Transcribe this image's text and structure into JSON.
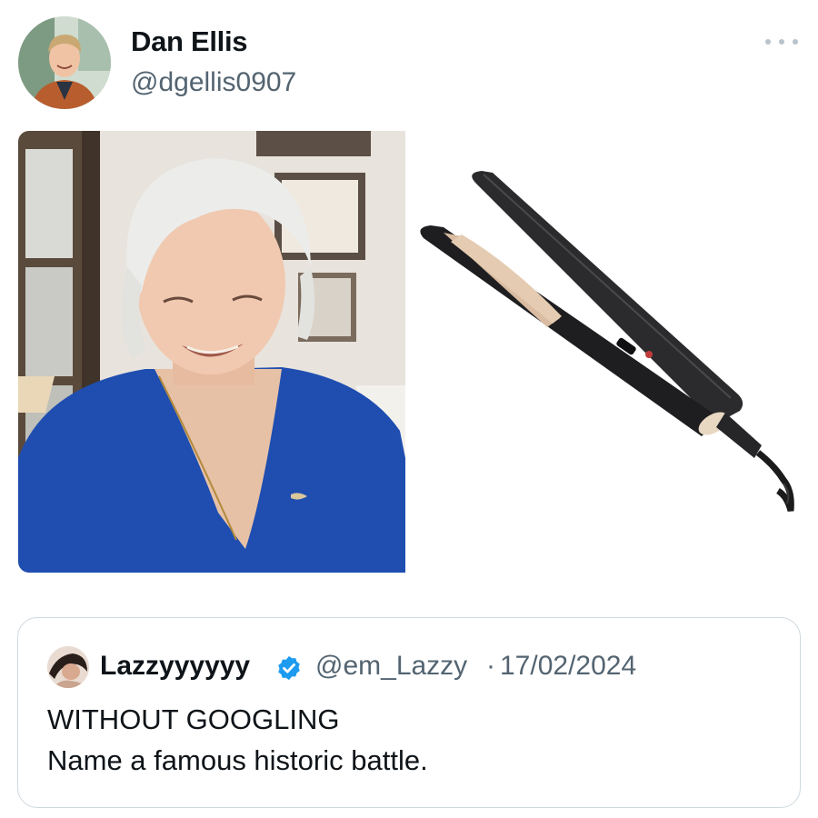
{
  "tweet": {
    "author": {
      "display_name": "Dan Ellis",
      "handle": "@dgellis0907",
      "avatar_icon": "user-avatar-photo"
    },
    "more_icon": "more-horizontal-icon",
    "media": [
      {
        "kind": "photo",
        "description_icon": "portrait-photo"
      },
      {
        "kind": "photo",
        "description_icon": "hair-straightener-photo"
      }
    ]
  },
  "quoted_tweet": {
    "display_name": "Lazzyyyyyy",
    "verified_icon": "verified-badge-icon",
    "verified_color": "#1d9bf0",
    "handle": "@em_Lazzy",
    "separator": "·",
    "date": "17/02/2024",
    "text_lines": [
      "WITHOUT GOOGLING",
      "Name a famous historic battle."
    ]
  },
  "colors": {
    "primary_text": "#0f1419",
    "secondary_text": "#536471",
    "border": "#cfd9de"
  }
}
